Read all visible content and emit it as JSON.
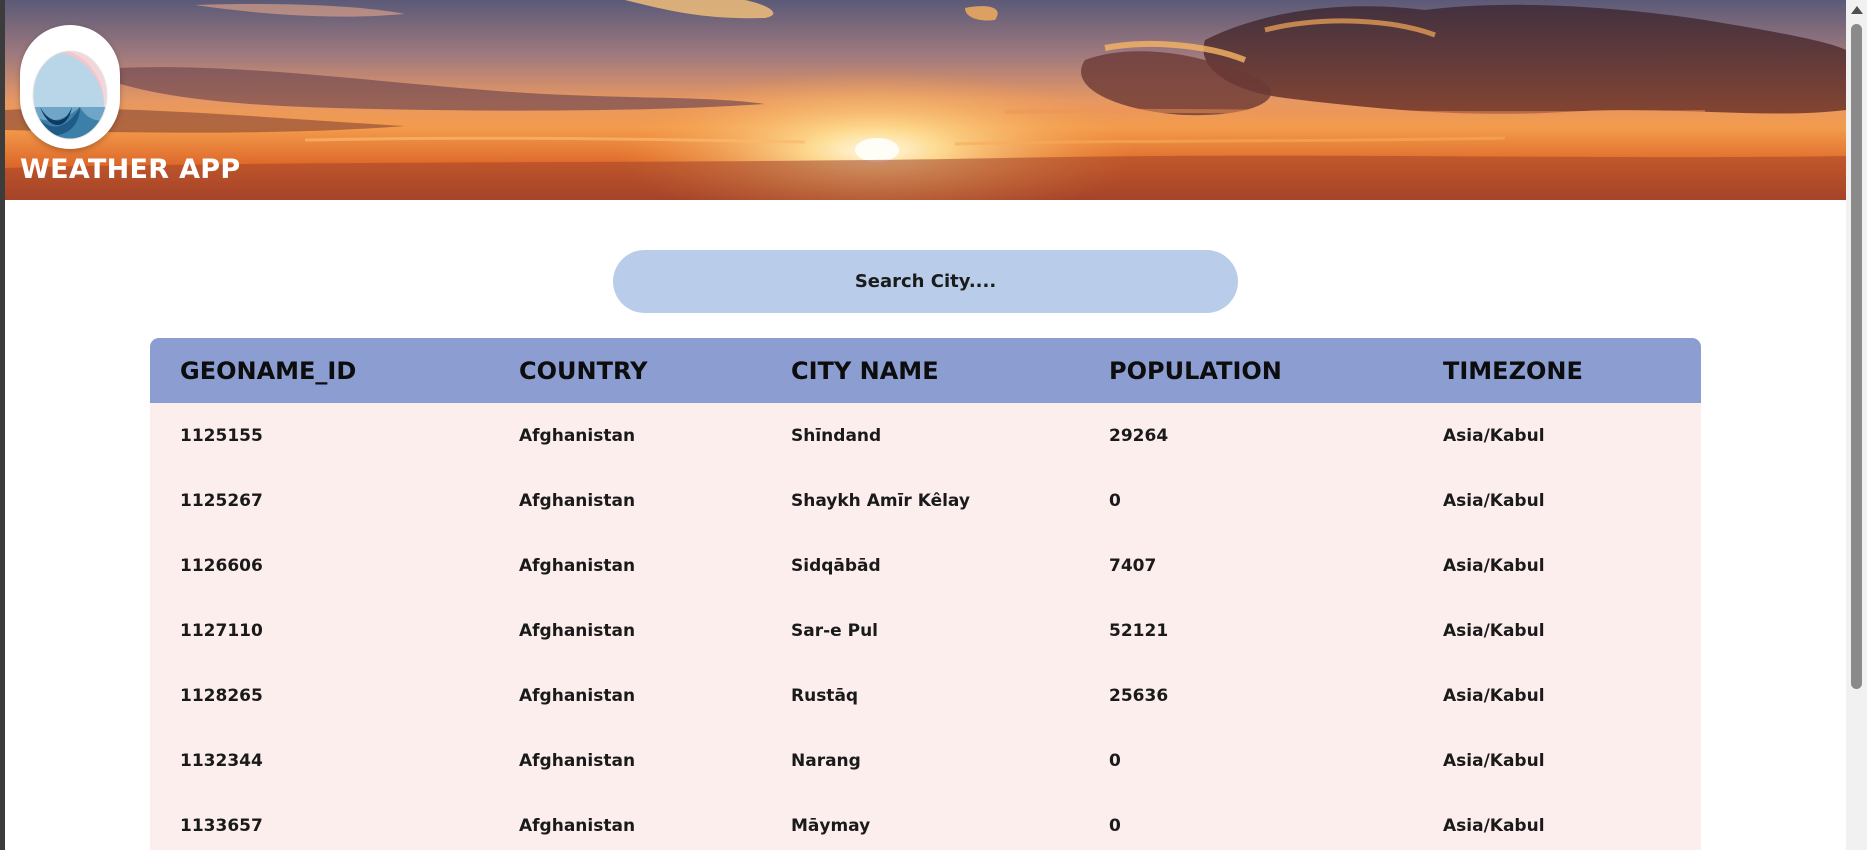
{
  "header": {
    "title": "WEATHER APP",
    "logo_icon": "weather-logo-icon"
  },
  "search": {
    "placeholder": "Search City...."
  },
  "table": {
    "columns": [
      "GEONAME_ID",
      "COUNTRY",
      "CITY NAME",
      "POPULATION",
      "TIMEZONE"
    ],
    "rows": [
      [
        "1125155",
        "Afghanistan",
        "Shīndand",
        "29264",
        "Asia/Kabul"
      ],
      [
        "1125267",
        "Afghanistan",
        "Shaykh Amīr Kêlay",
        "0",
        "Asia/Kabul"
      ],
      [
        "1126606",
        "Afghanistan",
        "Sidqābād",
        "7407",
        "Asia/Kabul"
      ],
      [
        "1127110",
        "Afghanistan",
        "Sar-e Pul",
        "52121",
        "Asia/Kabul"
      ],
      [
        "1128265",
        "Afghanistan",
        "Rustāq",
        "25636",
        "Asia/Kabul"
      ],
      [
        "1132344",
        "Afghanistan",
        "Narang",
        "0",
        "Asia/Kabul"
      ],
      [
        "1133657",
        "Afghanistan",
        "Māymay",
        "0",
        "Asia/Kabul"
      ]
    ]
  },
  "colors": {
    "header_row": "#8b9dd1",
    "body_rows": "#fdeeee",
    "search_bg": "#b9cdea",
    "title_text": "#ffffff"
  }
}
